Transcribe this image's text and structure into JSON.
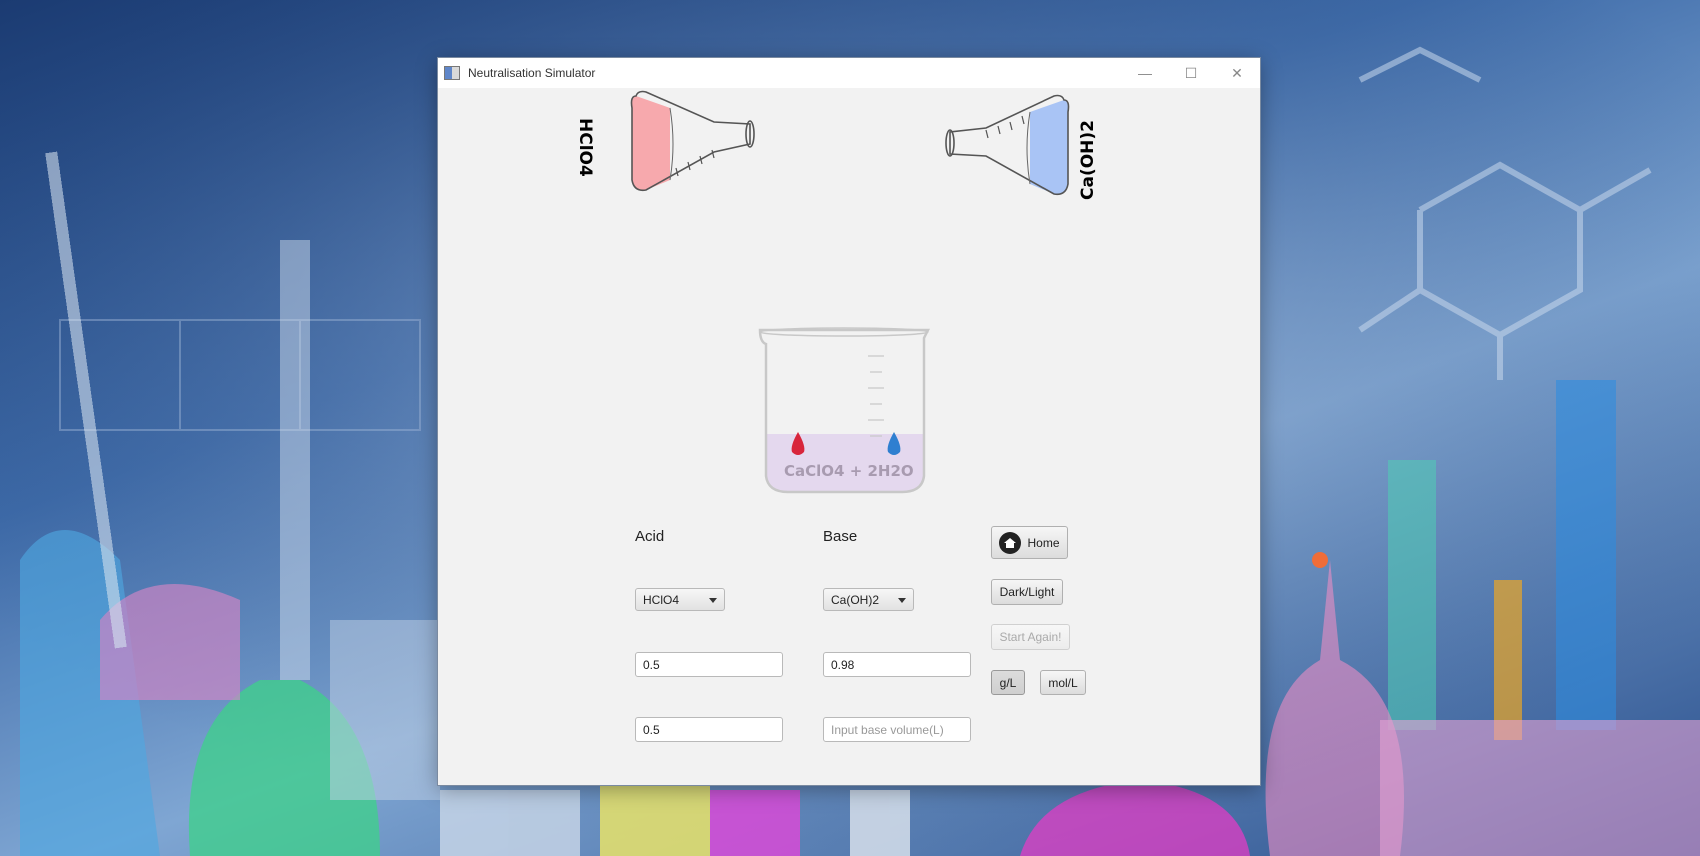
{
  "window": {
    "title": "Neutralisation Simulator",
    "controls": {
      "minimize": "—",
      "maximize": "☐",
      "close": "✕"
    }
  },
  "flasks": {
    "acid_label": "HClO4",
    "base_label": "Ca(OH)2",
    "acid_color": "#f7a9ad",
    "base_color": "#a9c4f5"
  },
  "beaker": {
    "product_label": "CaClO4 + 2H2O",
    "liquid_color": "#e4d8ee",
    "acid_drop_color": "#d8253b",
    "base_drop_color": "#2f7fd0"
  },
  "acid": {
    "heading": "Acid",
    "selected": "HClO4",
    "concentration": "0.5",
    "volume": "0.5"
  },
  "base": {
    "heading": "Base",
    "selected": "Ca(OH)2",
    "concentration": "0.98",
    "volume_placeholder": "Input base volume(L)"
  },
  "buttons": {
    "home": "Home",
    "theme": "Dark/Light",
    "restart": "Start Again!",
    "unit_gl": "g/L",
    "unit_moll": "mol/L"
  }
}
